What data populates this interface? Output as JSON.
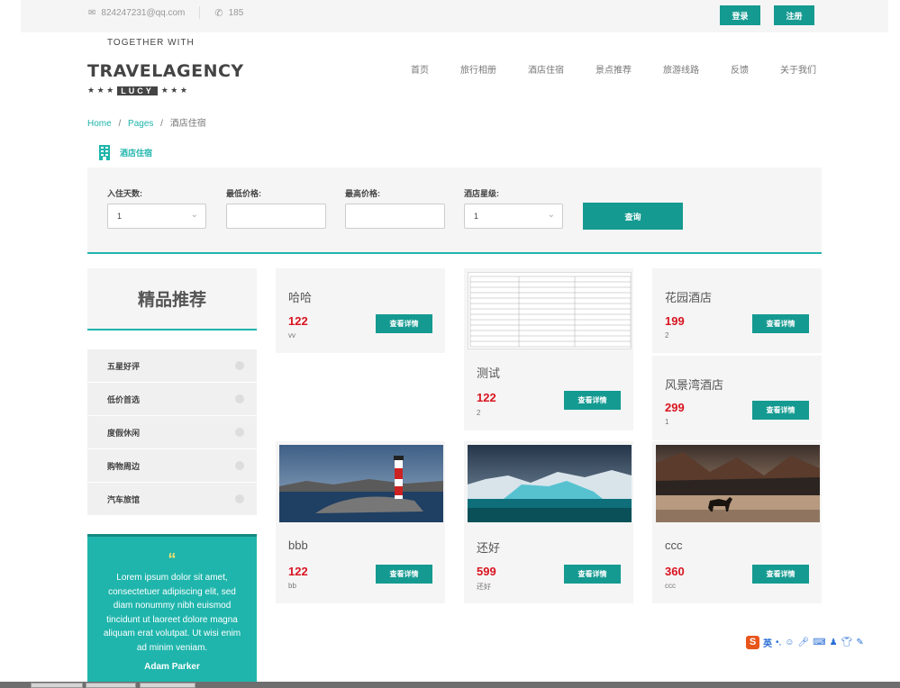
{
  "topbar": {
    "email": "824247231@qq.com",
    "phone": "185",
    "login_label": "登录",
    "register_label": "注册"
  },
  "logo": {
    "arc_text": "TOGETHER WITH",
    "main_text": "TRAVELAGENCY",
    "stars_left": "★ ★ ★",
    "badge": "LUCY",
    "stars_right": "★ ★ ★"
  },
  "nav": [
    "首页",
    "旅行相册",
    "酒店住宿",
    "景点推荐",
    "旅游线路",
    "反馈",
    "关于我们"
  ],
  "breadcrumb": {
    "home": "Home",
    "sep": "/",
    "pages": "Pages",
    "current": "酒店住宿"
  },
  "tab": {
    "label": "酒店住宿"
  },
  "search": {
    "days_label": "入住天数:",
    "days_value": "1",
    "min_price_label": "最低价格:",
    "min_price_value": "",
    "max_price_label": "最高价格:",
    "max_price_value": "",
    "stars_label": "酒店星级:",
    "stars_value": "1",
    "query_label": "查询"
  },
  "sidebar": {
    "title": "精品推荐",
    "items": [
      "五星好评",
      "低价首选",
      "度假休闲",
      "购物周边",
      "汽车旅馆"
    ]
  },
  "quote": {
    "mark": "“",
    "text": "Lorem ipsum dolor sit amet, consectetuer adipiscing elit, sed diam nonummy nibh euismod tincidunt ut laoreet dolore magna aliquam erat volutpat. Ut wisi enim ad minim veniam.",
    "author": "Adam Parker"
  },
  "cards": [
    {
      "name": "哈哈",
      "price": "122",
      "sub": "vv",
      "button": "查看详情"
    },
    {
      "name": "测试",
      "price": "122",
      "sub": "2",
      "button": "查看详情"
    },
    {
      "name": "花园酒店",
      "price": "199",
      "sub": "2",
      "button": "查看详情"
    },
    {
      "name": "风景湾酒店",
      "price": "299",
      "sub": "1",
      "button": "查看详情"
    },
    {
      "name": "bbb",
      "price": "122",
      "sub": "bb",
      "button": "查看详情"
    },
    {
      "name": "还好",
      "price": "599",
      "sub": "还好",
      "button": "查看详情"
    },
    {
      "name": "ccc",
      "price": "360",
      "sub": "ccc",
      "button": "查看详情"
    }
  ],
  "ime": {
    "logo": "S",
    "lang": "英"
  },
  "colors": {
    "accent": "#1fb5ac",
    "button": "#159a91",
    "price": "#d9141f"
  }
}
